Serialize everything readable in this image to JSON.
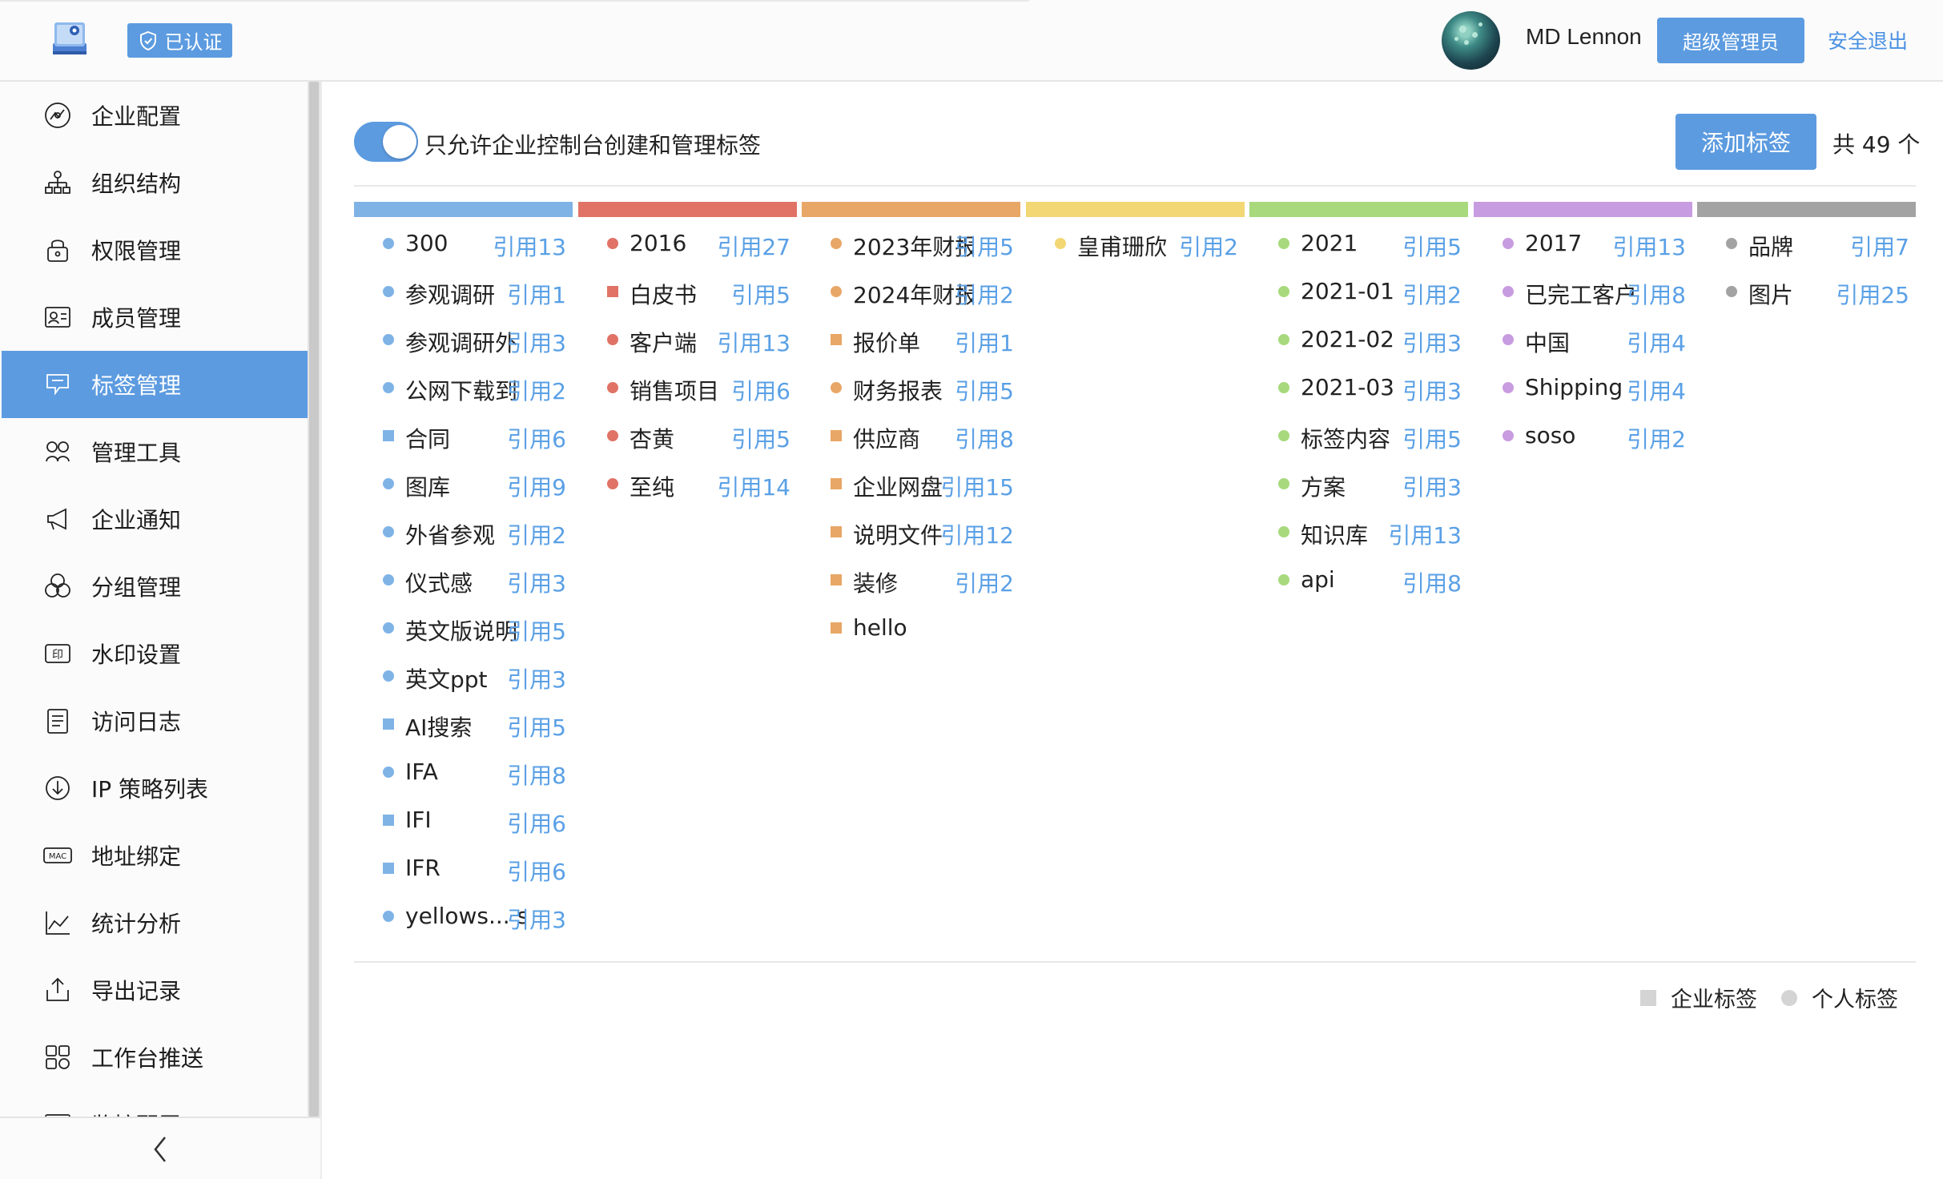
{
  "header": {
    "verified_label": "已认证",
    "username": "MD Lennon",
    "role_label": "超级管理员",
    "logout_label": "安全退出"
  },
  "sidebar": {
    "items": [
      {
        "label": "企业配置",
        "icon": "enterprise-config-icon"
      },
      {
        "label": "组织结构",
        "icon": "org-structure-icon"
      },
      {
        "label": "权限管理",
        "icon": "permission-lock-icon"
      },
      {
        "label": "成员管理",
        "icon": "member-card-icon"
      },
      {
        "label": "标签管理",
        "icon": "tag-icon",
        "active": true
      },
      {
        "label": "管理工具",
        "icon": "tools-icon"
      },
      {
        "label": "企业通知",
        "icon": "megaphone-icon"
      },
      {
        "label": "分组管理",
        "icon": "groups-icon"
      },
      {
        "label": "水印设置",
        "icon": "watermark-stamp-icon"
      },
      {
        "label": "访问日志",
        "icon": "log-list-icon"
      },
      {
        "label": "IP 策略列表",
        "icon": "ip-policy-icon"
      },
      {
        "label": "地址绑定",
        "icon": "mac-address-icon"
      },
      {
        "label": "统计分析",
        "icon": "chart-analytics-icon"
      },
      {
        "label": "导出记录",
        "icon": "export-icon"
      },
      {
        "label": "工作台推送",
        "icon": "workbench-grid-icon"
      },
      {
        "label": "监控配置",
        "icon": "monitor-icon"
      }
    ]
  },
  "main": {
    "toggle_label": "只允许企业控制台创建和管理标签",
    "toggle_on": true,
    "add_button_label": "添加标签",
    "total_label": "共 49 个",
    "legend": {
      "enterprise_label": "企业标签",
      "personal_label": "个人标签"
    },
    "columns": [
      {
        "color": "#7fb3e6",
        "tags": [
          {
            "name": "300",
            "ref": "引用13",
            "shape": "circle"
          },
          {
            "name": "参观调研",
            "ref": "引用1",
            "shape": "circle"
          },
          {
            "name": "参观调研外",
            "ref": "引用3",
            "shape": "circle"
          },
          {
            "name": "公网下载到",
            "ref": "引用2",
            "shape": "circle"
          },
          {
            "name": "合同",
            "ref": "引用6",
            "shape": "square"
          },
          {
            "name": "图库",
            "ref": "引用9",
            "shape": "circle"
          },
          {
            "name": "外省参观",
            "ref": "引用2",
            "shape": "circle"
          },
          {
            "name": "仪式感",
            "ref": "引用3",
            "shape": "circle"
          },
          {
            "name": "英文版说明",
            "ref": "引用5",
            "shape": "circle"
          },
          {
            "name": "英文ppt",
            "ref": "引用3",
            "shape": "circle"
          },
          {
            "name": "AI搜索",
            "ref": "引用5",
            "shape": "square"
          },
          {
            "name": "IFA",
            "ref": "引用8",
            "shape": "circle"
          },
          {
            "name": "IFI",
            "ref": "引用6",
            "shape": "square"
          },
          {
            "name": "IFR",
            "ref": "引用6",
            "shape": "square"
          },
          {
            "name": "yellows... s",
            "ref": "引用3",
            "shape": "circle"
          }
        ]
      },
      {
        "color": "#e07366",
        "tags": [
          {
            "name": "2016",
            "ref": "引用27",
            "shape": "circle"
          },
          {
            "name": "白皮书",
            "ref": "引用5",
            "shape": "square"
          },
          {
            "name": "客户端",
            "ref": "引用13",
            "shape": "circle"
          },
          {
            "name": "销售项目",
            "ref": "引用6",
            "shape": "circle"
          },
          {
            "name": "杏黄",
            "ref": "引用5",
            "shape": "circle"
          },
          {
            "name": "至纯",
            "ref": "引用14",
            "shape": "circle"
          }
        ]
      },
      {
        "color": "#e8a766",
        "tags": [
          {
            "name": "2023年财报",
            "ref": "引用5",
            "shape": "circle"
          },
          {
            "name": "2024年财报",
            "ref": "引用2",
            "shape": "circle"
          },
          {
            "name": "报价单",
            "ref": "引用1",
            "shape": "square"
          },
          {
            "name": "财务报表",
            "ref": "引用5",
            "shape": "circle"
          },
          {
            "name": "供应商",
            "ref": "引用8",
            "shape": "square"
          },
          {
            "name": "企业网盘",
            "ref": "引用15",
            "shape": "square"
          },
          {
            "name": "说明文件",
            "ref": "引用12",
            "shape": "square"
          },
          {
            "name": "装修",
            "ref": "引用2",
            "shape": "square"
          },
          {
            "name": "hello",
            "ref": "",
            "shape": "square"
          }
        ]
      },
      {
        "color": "#f3d774",
        "tags": [
          {
            "name": "皇甫珊欣",
            "ref": "引用2",
            "shape": "circle"
          }
        ]
      },
      {
        "color": "#a8d97d",
        "tags": [
          {
            "name": "2021",
            "ref": "引用5",
            "shape": "circle"
          },
          {
            "name": "2021-01",
            "ref": "引用2",
            "shape": "circle"
          },
          {
            "name": "2021-02",
            "ref": "引用3",
            "shape": "circle"
          },
          {
            "name": "2021-03",
            "ref": "引用3",
            "shape": "circle"
          },
          {
            "name": "标签内容",
            "ref": "引用5",
            "shape": "circle"
          },
          {
            "name": "方案",
            "ref": "引用3",
            "shape": "circle"
          },
          {
            "name": "知识库",
            "ref": "引用13",
            "shape": "circle"
          },
          {
            "name": "api",
            "ref": "引用8",
            "shape": "circle"
          }
        ]
      },
      {
        "color": "#c89ce0",
        "tags": [
          {
            "name": "2017",
            "ref": "引用13",
            "shape": "circle"
          },
          {
            "name": "已完工客户",
            "ref": "引用8",
            "shape": "circle"
          },
          {
            "name": "中国",
            "ref": "引用4",
            "shape": "circle"
          },
          {
            "name": "Shipping",
            "ref": "引用4",
            "shape": "circle"
          },
          {
            "name": "soso",
            "ref": "引用2",
            "shape": "circle"
          }
        ]
      },
      {
        "color": "#a3a3a3",
        "tags": [
          {
            "name": "品牌",
            "ref": "引用7",
            "shape": "circle"
          },
          {
            "name": "图片",
            "ref": "引用25",
            "shape": "circle"
          }
        ]
      }
    ]
  }
}
